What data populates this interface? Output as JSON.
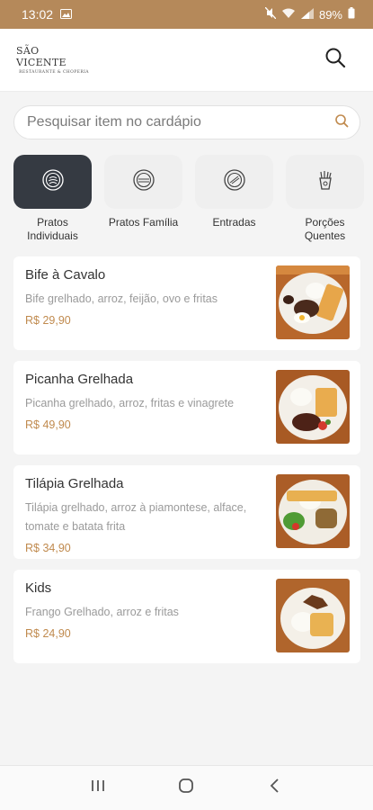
{
  "status_bar": {
    "time": "13:02",
    "battery": "89%",
    "background_color": "#b5895a"
  },
  "header": {
    "logo_main": "SÃO VICENTE",
    "logo_sub": "RESTAURANTE & CHOPERIA",
    "search_icon": "search-icon"
  },
  "search": {
    "placeholder": "Pesquisar item no cardápio",
    "icon": "search-icon",
    "icon_color": "#c08a4e"
  },
  "categories": [
    {
      "label": "Pratos Individuais",
      "icon": "plate-icon",
      "active": true
    },
    {
      "label": "Pratos Família",
      "icon": "plate-icon",
      "active": false
    },
    {
      "label": "Entradas",
      "icon": "plate-icon",
      "active": false
    },
    {
      "label": "Porções Quentes",
      "icon": "fries-icon",
      "active": false
    }
  ],
  "menu_items": [
    {
      "name": "Bife à Cavalo",
      "description": "Bife grelhado, arroz, feijão, ovo e fritas",
      "price": "R$ 29,90"
    },
    {
      "name": "Picanha Grelhada",
      "description": "Picanha grelhado, arroz, fritas e vinagrete",
      "price": "R$ 49,90"
    },
    {
      "name": "Tilápia Grelhada",
      "description": "Tilápia grelhado, arroz à piamontese, alface, tomate e batata frita",
      "price": "R$ 34,90"
    },
    {
      "name": "Kids",
      "description": "Frango Grelhado, arroz e fritas",
      "price": "R$ 24,90"
    }
  ],
  "colors": {
    "accent": "#c08a4e",
    "active_category": "#353a42"
  }
}
